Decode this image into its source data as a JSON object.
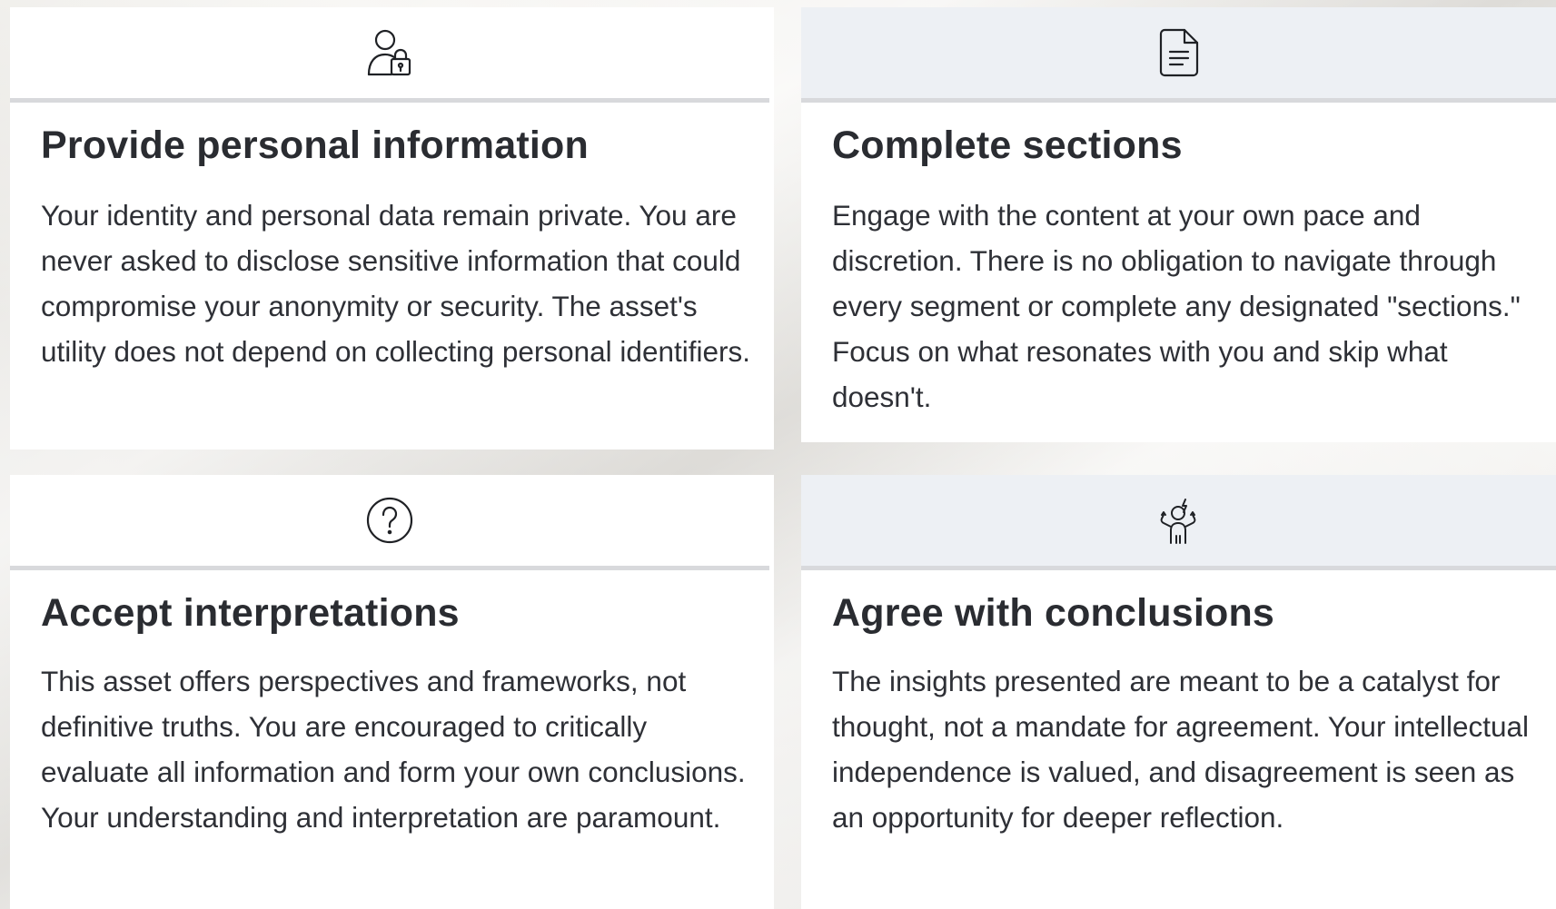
{
  "cards": [
    {
      "icon": "user-lock-icon",
      "title": "Provide personal information",
      "text": "Your identity and personal data remain private. You are never asked to disclose sensitive information that could compromise your anonymity or security. The asset's utility does not depend on collecting personal identifiers."
    },
    {
      "icon": "document-icon",
      "title": "Complete sections",
      "text": "Engage with the content at your own pace and discretion. There is no obligation to navigate through every segment or complete any designated \"sections.\" Focus on what resonates with you and skip what doesn't."
    },
    {
      "icon": "question-circle-icon",
      "title": "Accept interpretations",
      "text": "This asset offers perspectives and frameworks, not definitive truths. You are encouraged to critically evaluate all information and form your own conclusions. Your understanding and interpretation are paramount."
    },
    {
      "icon": "frustrated-person-icon",
      "title": "Agree with conclusions",
      "text": "The insights presented are meant to be a catalyst for thought, not a mandate for agreement. Your intellectual independence is valued, and disagreement is seen as an opportunity for deeper reflection."
    }
  ],
  "colors": {
    "title": "#2a2c31",
    "text": "#2e3036",
    "header_tint": "#edf0f4",
    "header_rule": "#d8d9dc"
  }
}
